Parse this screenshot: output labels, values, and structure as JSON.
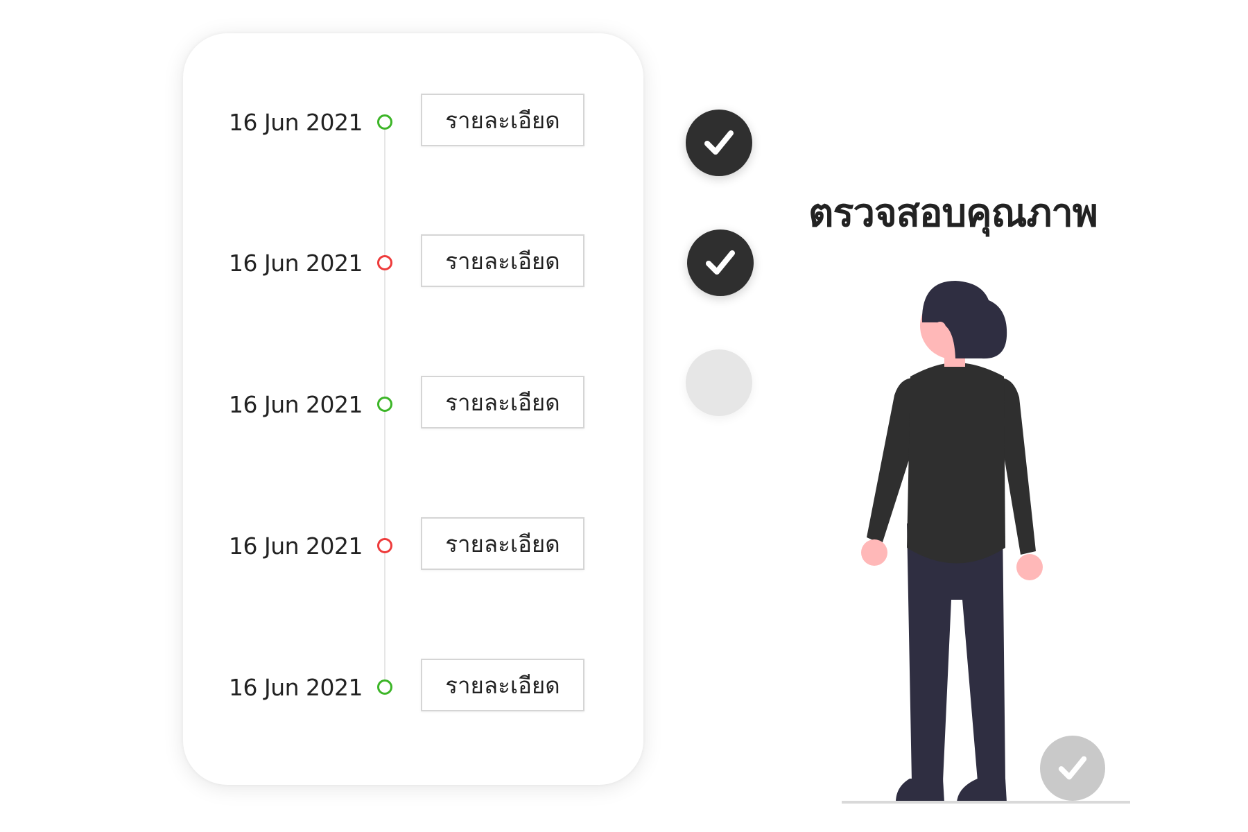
{
  "timeline": {
    "items": [
      {
        "date": "16 Jun 2021",
        "status": "green",
        "button_label": "รายละเอียด"
      },
      {
        "date": "16 Jun 2021",
        "status": "red",
        "button_label": "รายละเอียด"
      },
      {
        "date": "16 Jun 2021",
        "status": "green",
        "button_label": "รายละเอียด"
      },
      {
        "date": "16 Jun 2021",
        "status": "red",
        "button_label": "รายละเอียด"
      },
      {
        "date": "16 Jun 2021",
        "status": "green",
        "button_label": "รายละเอียด"
      }
    ]
  },
  "checklist": [
    {
      "icon": "check-icon",
      "state": "checked"
    },
    {
      "icon": "check-icon",
      "state": "checked"
    },
    {
      "icon": "",
      "state": "empty"
    }
  ],
  "headline": "ตรวจสอบคุณภาพ",
  "colors": {
    "status_green": "#3cb527",
    "status_red": "#ee3b3b",
    "check_dark": "#2f2f2f",
    "check_empty": "#e6e6e6",
    "check_light": "#c9c9c9"
  }
}
